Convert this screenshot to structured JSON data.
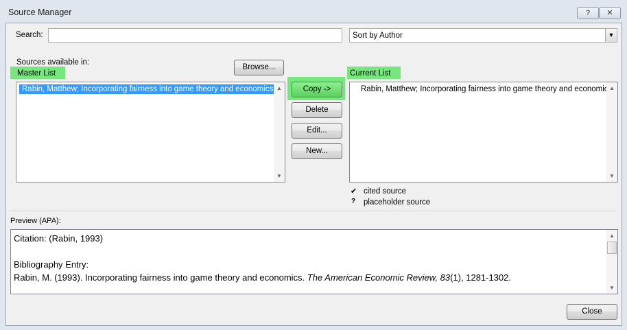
{
  "window": {
    "title": "Source Manager",
    "help_label": "?",
    "close_glyph": "✕"
  },
  "search": {
    "label": "Search:",
    "value": "",
    "placeholder": ""
  },
  "sort": {
    "selected": "Sort by Author"
  },
  "sources_available_label": "Sources available in:",
  "master_list": {
    "label": "Master List",
    "items": [
      "Rabin, Matthew; Incorporating fairness into game theory and economics"
    ]
  },
  "browse_label": "Browse...",
  "current_list": {
    "label": "Current List",
    "items": [
      "Rabin, Matthew; Incorporating fairness into game theory and economics"
    ]
  },
  "buttons": {
    "copy": "Copy ->",
    "delete": "Delete",
    "edit": "Edit...",
    "new": "New...",
    "close": "Close"
  },
  "legend": [
    {
      "glyph": "✔",
      "text": "cited source"
    },
    {
      "glyph": "?",
      "text": "placeholder source"
    }
  ],
  "preview": {
    "label": "Preview (APA):",
    "citation": "Citation:  (Rabin, 1993)",
    "bib_heading": "Bibliography Entry:",
    "bib_plain": "Rabin, M. (1993). Incorporating fairness into game theory and economics. ",
    "bib_journal": "The American Economic Review, 83",
    "bib_issue": "(1), 1281-1302."
  },
  "colors": {
    "highlight": "#77e67e",
    "selection": "#3399ff"
  }
}
